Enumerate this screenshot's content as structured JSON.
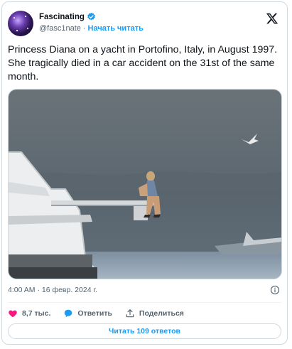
{
  "author": {
    "display_name": "Fascinating",
    "handle": "@fasc1nate",
    "separator": "·",
    "follow_label": "Начать читать"
  },
  "icons": {
    "verified": "verified-badge-icon",
    "brand": "x-logo-icon",
    "info": "info-icon",
    "like": "heart-icon",
    "reply": "speech-bubble-icon",
    "share": "share-upload-icon"
  },
  "colors": {
    "accent": "#1d9bf0",
    "like": "#f91880",
    "muted": "#536471",
    "text": "#0f1419"
  },
  "tweet": {
    "text": "Princess Diana on a yacht in Portofino, Italy, in August 1997. She tragically died in a car accident on the 31st of the same month.",
    "timestamp": "4:00 AM · 16 февр. 2024 г."
  },
  "actions": {
    "likes": "8,7 тыс.",
    "reply_label": "Ответить",
    "share_label": "Поделиться"
  },
  "footer": {
    "read_replies": "Читать 109 ответов"
  }
}
